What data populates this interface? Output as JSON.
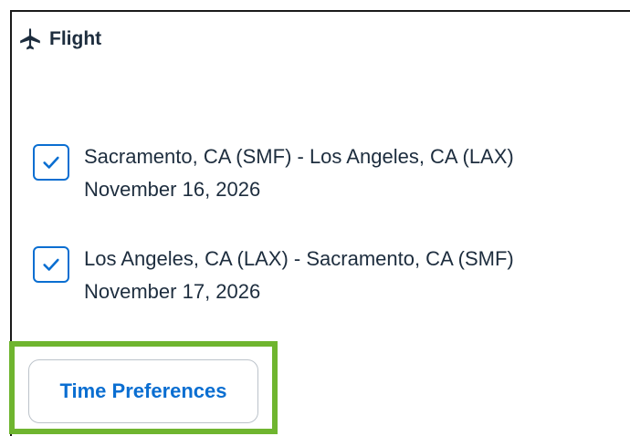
{
  "section": {
    "title": "Flight",
    "icon": "airplane-icon"
  },
  "flights": [
    {
      "route": "Sacramento, CA (SMF) - Los Angeles, CA (LAX)",
      "date": "November 16, 2026",
      "checked": true
    },
    {
      "route": "Los Angeles, CA (LAX) - Sacramento, CA (SMF)",
      "date": "November 17, 2026",
      "checked": true
    }
  ],
  "actions": {
    "time_preferences_label": "Time Preferences"
  },
  "colors": {
    "accent": "#0a6ed1",
    "highlight": "#6fb52f",
    "text": "#1d2d3e"
  }
}
